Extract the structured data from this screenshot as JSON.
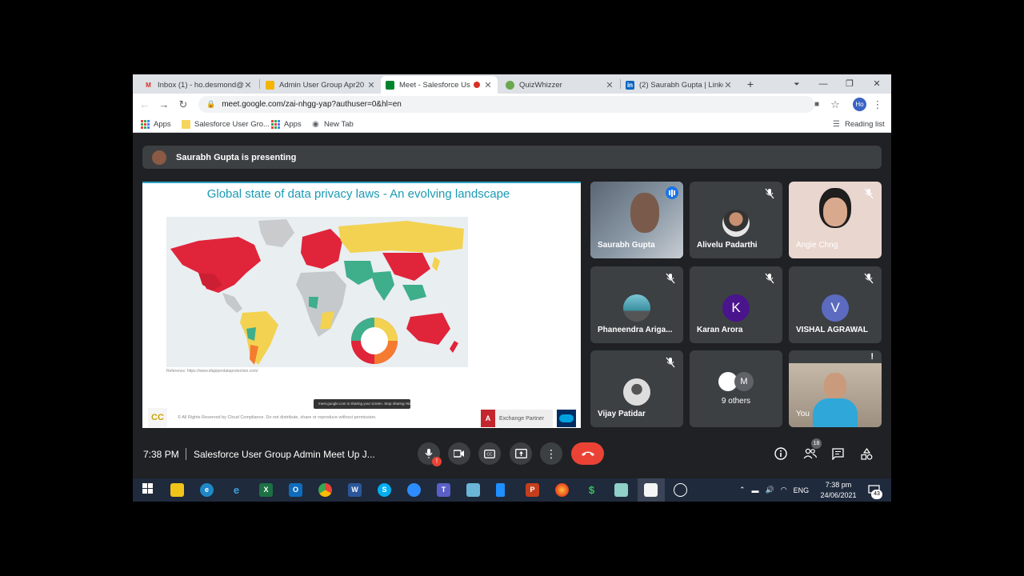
{
  "browser": {
    "tabs": [
      {
        "title": "Inbox (1) - ho.desmond@",
        "icon": "gmail-icon",
        "active": false
      },
      {
        "title": "Admin User Group Apr20",
        "icon": "slides-icon",
        "active": false
      },
      {
        "title": "Meet - Salesforce Use",
        "icon": "meet-icon",
        "active": true
      },
      {
        "title": "QuizWhizzer",
        "icon": "quiz-icon",
        "active": false
      },
      {
        "title": "(2) Saurabh Gupta | Linke",
        "icon": "linkedin-icon",
        "active": false
      }
    ],
    "url": "meet.google.com/zai-nhgg-yap?authuser=0&hl=en",
    "profile_initials": "Ho",
    "bookmarks": [
      "Apps",
      "Salesforce User Gro...",
      "Apps",
      "New Tab"
    ],
    "reading_list": "Reading list"
  },
  "meet": {
    "presenting_banner": "Saurabh Gupta is presenting",
    "slide": {
      "title": "Global state of data privacy laws - An evolving landscape",
      "reference": "Reference: https://www.dlapiperdataprotection.com/",
      "notice": "meet.google.com is sharing your screen.   Stop sharing   Hide",
      "footer": "© All Rights Reserved by Cloud Compliance. Do not distribute, share or reproduce without permission.",
      "logo_text": "CC",
      "partner_text": "Exchange Partner",
      "partner_small": "PREMIERE",
      "adobe": "A"
    },
    "participants": [
      {
        "name": "Saurabh Gupta",
        "type": "video",
        "speaking": true
      },
      {
        "name": "Alivelu Padarthi",
        "type": "photo",
        "muted": true
      },
      {
        "name": "Angie Chng",
        "type": "video",
        "muted": true
      },
      {
        "name": "Phaneendra Ariga...",
        "type": "photo",
        "muted": true
      },
      {
        "name": "Karan Arora",
        "type": "initial",
        "initial": "K",
        "color": "#4a148c",
        "muted": true
      },
      {
        "name": "VISHAL AGRAWAL",
        "type": "initial",
        "initial": "V",
        "color": "#5c6bc0",
        "muted": true
      },
      {
        "name": "Vijay Patidar",
        "type": "photo",
        "muted": true
      },
      {
        "name": "9 others",
        "type": "others",
        "initial": "M"
      },
      {
        "name": "You",
        "type": "video"
      }
    ],
    "time": "7:38 PM",
    "meeting_title": "Salesforce User Group Admin Meet Up J...",
    "people_count": "18"
  },
  "taskbar": {
    "language": "ENG",
    "time": "7:38 pm",
    "date": "24/06/2021",
    "notifications": "43"
  }
}
